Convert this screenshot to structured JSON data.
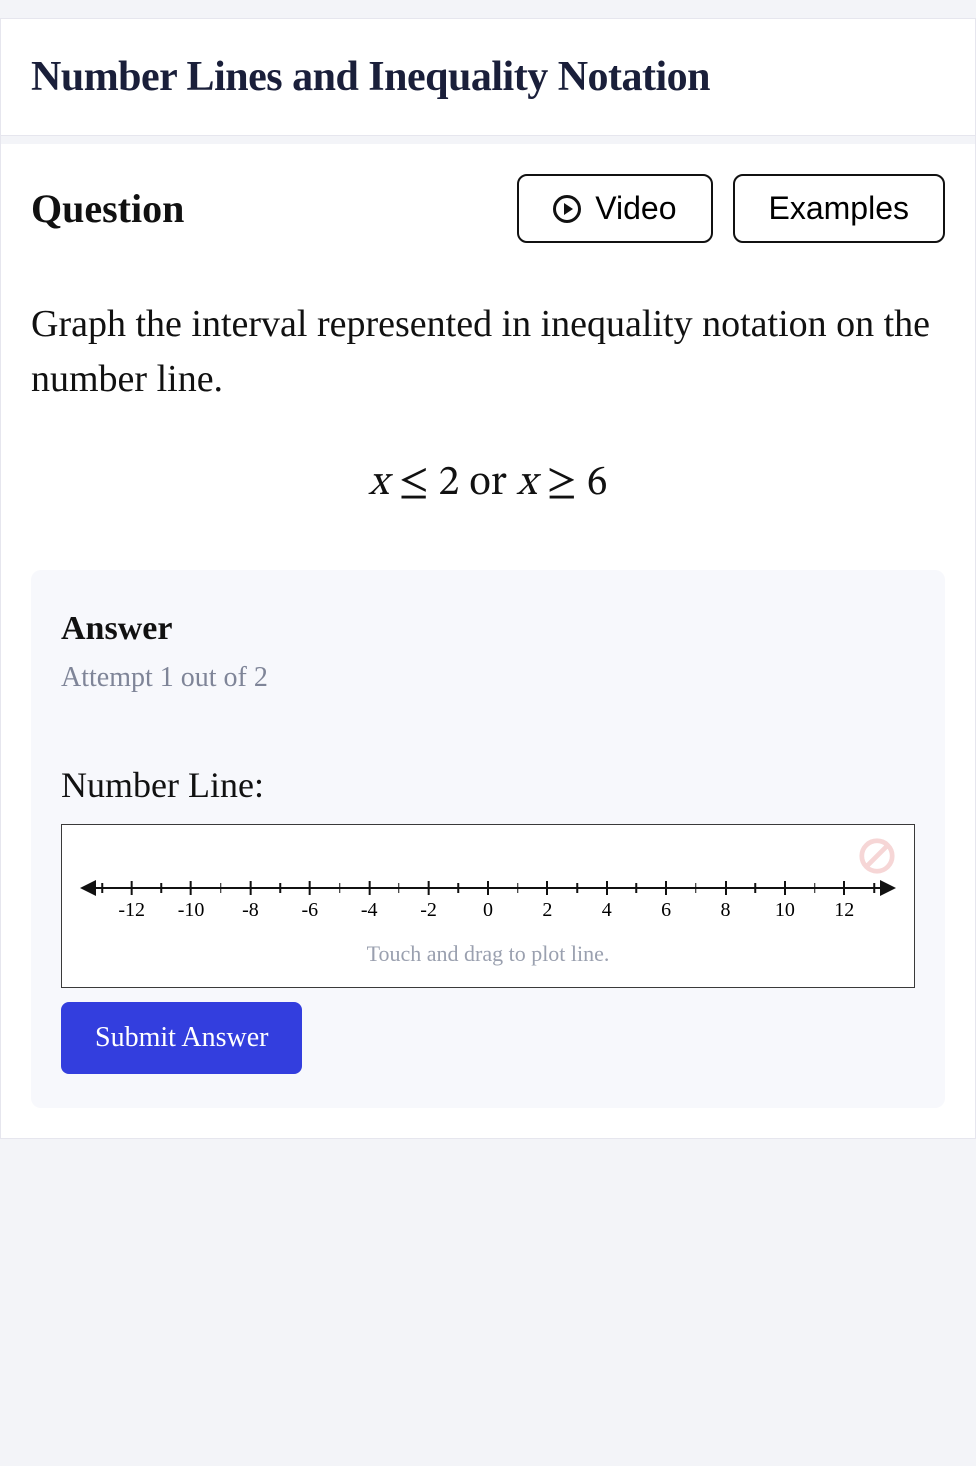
{
  "title": "Number Lines and Inequality Notation",
  "question": {
    "label": "Question",
    "video_button": "Video",
    "examples_button": "Examples",
    "prompt": "Graph the interval represented in inequality notation on the number line.",
    "inequality_text": "x ≤ 2 or x ≥ 6"
  },
  "answer": {
    "heading": "Answer",
    "attempt_text": "Attempt 1 out of 2",
    "numberline_label": "Number Line:",
    "hint": "Touch and drag to plot line.",
    "submit_label": "Submit Answer"
  },
  "chart_data": {
    "type": "numberline",
    "min": -13,
    "max": 13,
    "major_tick_step": 2,
    "minor_tick_step": 1,
    "tick_labels": [
      -12,
      -10,
      -8,
      -6,
      -4,
      -2,
      0,
      2,
      4,
      6,
      8,
      10,
      12
    ]
  }
}
